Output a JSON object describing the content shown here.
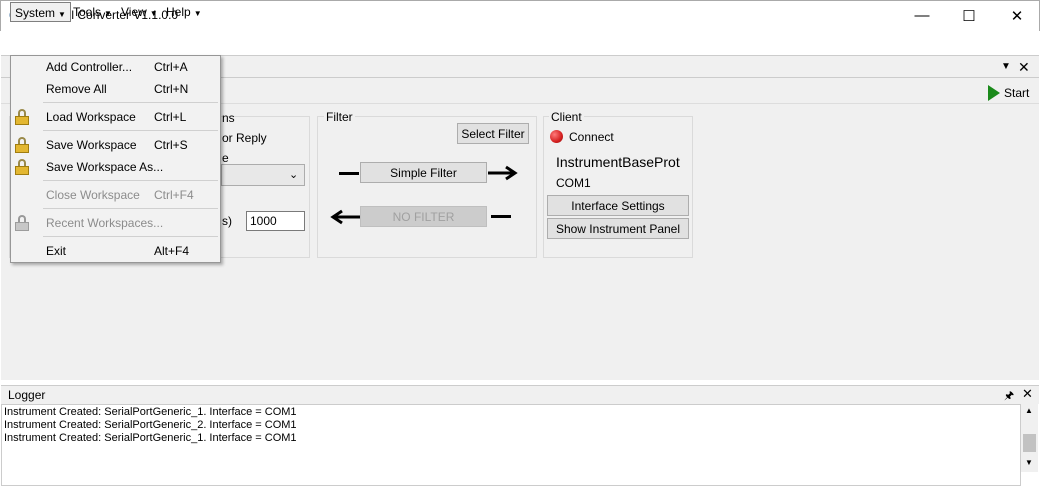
{
  "window": {
    "title": "Protocol Converter V1.1.0.0",
    "minimize": "—",
    "maximize": "☐",
    "close": "✕"
  },
  "menubar": {
    "system": "System",
    "tools": "Tools",
    "view": "View",
    "help": "Help"
  },
  "doc_tabs": {
    "dropdown": "▼",
    "close": "✕"
  },
  "toolbar": {
    "start_label": "Start"
  },
  "controller": {
    "partial_label_1": "ns",
    "partial_label_2": "or Reply",
    "partial_label_3": "e",
    "partial_label_4": "s)",
    "timeout_value": "1000"
  },
  "filter": {
    "label": "Filter",
    "select_button": "Select Filter",
    "simple_filter_button": "Simple Filter",
    "no_filter_button": "NO FILTER"
  },
  "client": {
    "label": "Client",
    "connect_label": "Connect",
    "instrument_name": "InstrumentBaseProt",
    "port": "COM1",
    "interface_settings_button": "Interface Settings",
    "show_panel_button": "Show Instrument Panel"
  },
  "system_menu": {
    "items": [
      {
        "label": "Add Controller...",
        "shortcut": "Ctrl+A"
      },
      {
        "label": "Remove All",
        "shortcut": "Ctrl+N"
      },
      {
        "label": "Load Workspace",
        "shortcut": "Ctrl+L"
      },
      {
        "label": "Save Workspace",
        "shortcut": "Ctrl+S"
      },
      {
        "label": "Save Workspace As...",
        "shortcut": ""
      },
      {
        "label": "Close Workspace",
        "shortcut": "Ctrl+F4"
      },
      {
        "label": "Recent Workspaces...",
        "shortcut": ""
      },
      {
        "label": "Exit",
        "shortcut": "Alt+F4"
      }
    ]
  },
  "logger": {
    "title": "Logger",
    "pin": "🖈",
    "close": "✕",
    "lines": [
      "Instrument Created: SerialPortGeneric_1. Interface = COM1",
      "Instrument Created: SerialPortGeneric_2. Interface = COM1",
      "Instrument Created: SerialPortGeneric_1. Interface = COM1"
    ]
  },
  "colors": {
    "accent_green": "#1b8a1b",
    "status_red": "#d42020",
    "window_bg": "#f0f0f0"
  }
}
